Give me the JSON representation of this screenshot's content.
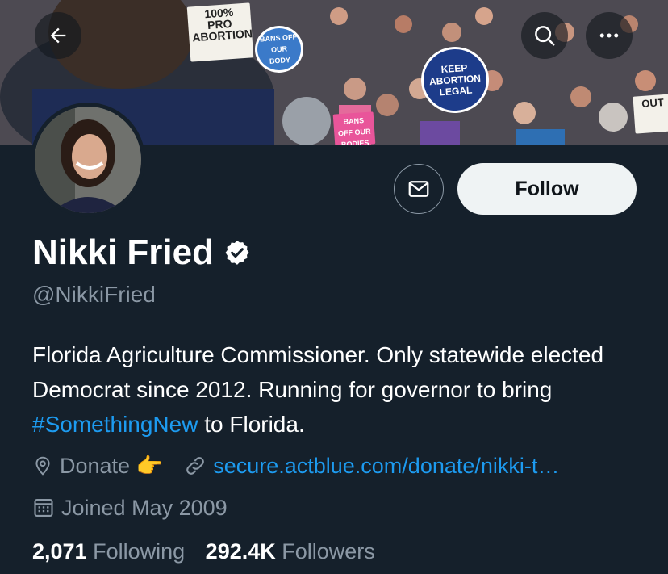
{
  "banner": {
    "signs": [
      "100% PRO ABORTION",
      "BANS OFF OUR BODY",
      "KEEP ABORTION LEGAL",
      "BANS OFF OUR BODIES",
      "OUT"
    ],
    "back_icon": "arrow-left-icon",
    "search_icon": "search-icon",
    "more_icon": "more-horizontal-icon"
  },
  "profile": {
    "name": "Nikki Fried",
    "verified_icon": "verified-badge-icon",
    "handle": "@NikkiFried",
    "bio_before": "Florida Agriculture Commissioner. Only statewide elected Democrat since 2012. Running for governor to bring ",
    "bio_hashtag": "#SomethingNew",
    "bio_after": " to Florida.",
    "location": "Donate 👉",
    "link": "secure.actblue.com/donate/nikki-t…",
    "joined": "Joined May 2009",
    "following_count": "2,071",
    "following_label": "Following",
    "followers_count": "292.4K",
    "followers_label": "Followers"
  },
  "actions": {
    "message_icon": "mail-icon",
    "follow_label": "Follow"
  },
  "colors": {
    "background": "#15202b",
    "accent": "#1d9bf0",
    "muted": "#8b98a5",
    "follow_bg": "#eff3f4"
  }
}
